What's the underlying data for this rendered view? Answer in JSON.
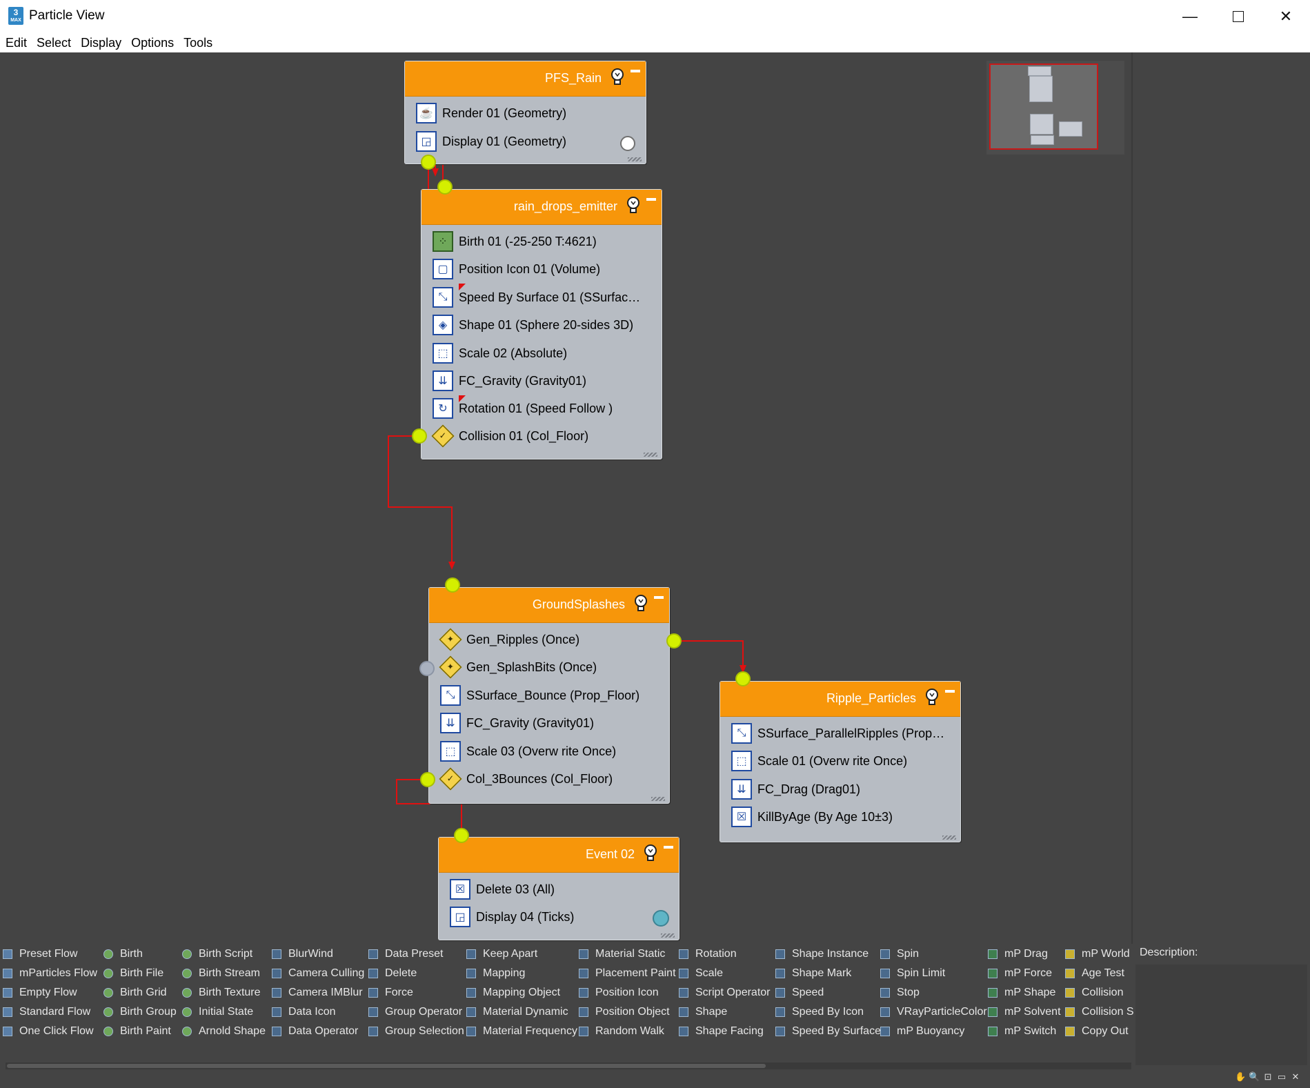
{
  "window": {
    "title": "Particle View",
    "icon_label": "3",
    "icon_sub": "MAX"
  },
  "menu": [
    "Edit",
    "Select",
    "Display",
    "Options",
    "Tools"
  ],
  "nodes": {
    "pfs_rain": {
      "title": "PFS_Rain",
      "ops": [
        "Render 01 (Geometry)",
        "Display 01 (Geometry)"
      ]
    },
    "rain_drops_emitter": {
      "title": "rain_drops_emitter",
      "ops": [
        "Birth 01 (-25-250 T:4621)",
        "Position Icon 01 (Volume)",
        "Speed By Surface 01 (SSurfac…",
        "Shape 01 (Sphere 20-sides 3D)",
        "Scale 02 (Absolute)",
        "FC_Gravity (Gravity01)",
        "Rotation 01 (Speed Follow )",
        "Collision 01 (Col_Floor)"
      ]
    },
    "ground_splashes": {
      "title": "GroundSplashes",
      "ops": [
        "Gen_Ripples (Once)",
        "Gen_SplashBits (Once)",
        "SSurface_Bounce (Prop_Floor)",
        "FC_Gravity (Gravity01)",
        "Scale 03 (Overw rite Once)",
        "Col_3Bounces (Col_Floor)"
      ]
    },
    "ripple_particles": {
      "title": "Ripple_Particles",
      "ops": [
        "SSurface_ParallelRipples (Prop…",
        "Scale 01 (Overw rite Once)",
        "FC_Drag (Drag01)",
        "KillByAge (By Age 10±3)"
      ]
    },
    "event02": {
      "title": "Event 02",
      "ops": [
        "Delete 03 (All)",
        "Display 04 (Ticks)"
      ]
    }
  },
  "depot": {
    "columns": [
      [
        "Preset Flow",
        "mParticles Flow",
        "Empty Flow",
        "Standard Flow",
        "One Click Flow"
      ],
      [
        "Birth",
        "Birth File",
        "Birth Grid",
        "Birth Group",
        "Birth Paint"
      ],
      [
        "Birth Script",
        "Birth Stream",
        "Birth Texture",
        "Initial State",
        "Arnold Shape"
      ],
      [
        "BlurWind",
        "Camera Culling",
        "Camera IMBlur",
        "Data Icon",
        "Data Operator"
      ],
      [
        "Data Preset",
        "Delete",
        "Force",
        "Group Operator",
        "Group Selection"
      ],
      [
        "Keep Apart",
        "Mapping",
        "Mapping Object",
        "Material Dynamic",
        "Material Frequency"
      ],
      [
        "Material Static",
        "Placement Paint",
        "Position Icon",
        "Position Object",
        "Random Walk"
      ],
      [
        "Rotation",
        "Scale",
        "Script Operator",
        "Shape",
        "Shape Facing"
      ],
      [
        "Shape Instance",
        "Shape Mark",
        "Speed",
        "Speed By Icon",
        "Speed By Surface"
      ],
      [
        "Spin",
        "Spin Limit",
        "Stop",
        "VRayParticleColor",
        "mP Buoyancy"
      ],
      [
        "mP Drag",
        "mP Force",
        "mP Shape",
        "mP Solvent",
        "mP Switch"
      ],
      [
        "mP World",
        "Age Test",
        "Collision",
        "Collision S",
        "Copy Out"
      ]
    ]
  },
  "description_label": "Description:",
  "colors": {
    "event_header": "#f7960a",
    "canvas_bg": "#444444",
    "wire": "#e01010",
    "port": "#d4ef00"
  }
}
